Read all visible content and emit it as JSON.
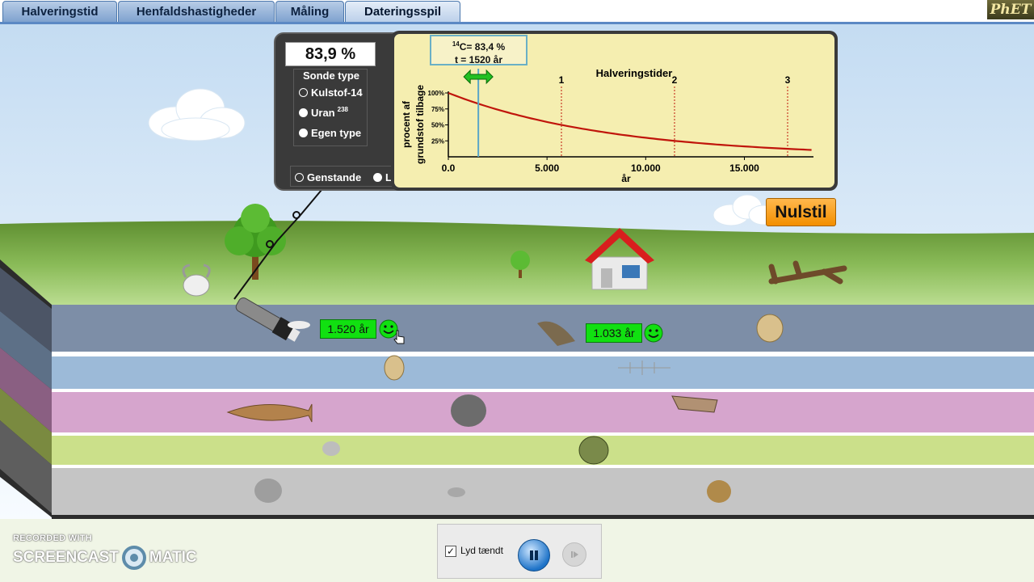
{
  "tabs": [
    {
      "label": "Halveringstid"
    },
    {
      "label": "Henfaldshastigheder"
    },
    {
      "label": "Måling"
    },
    {
      "label": "Dateringsspil"
    }
  ],
  "active_tab": "Dateringsspil",
  "logo_text": "PhET",
  "probe": {
    "reading": "83,9 %",
    "type_title": "Sonde type",
    "options": [
      {
        "label": "Kulstof-14",
        "selected": true
      },
      {
        "label": "Uran",
        "superscript": "238",
        "selected": false
      },
      {
        "label": "Egen type",
        "selected": false
      }
    ],
    "mode_options": [
      {
        "label": "Genstande",
        "selected": true
      },
      {
        "label": "Luft",
        "selected": false
      }
    ]
  },
  "graph": {
    "tooltip_line1_sup": "14",
    "tooltip_line1": "C= 83,4 %",
    "tooltip_line2": "t = 1520 år",
    "title": "Halveringstider",
    "ylabel_line1": "procent af",
    "ylabel_line2": "grundstof tilbage",
    "xlabel": "år",
    "y_ticks": [
      "100%",
      "75%",
      "50%",
      "25%"
    ],
    "x_ticks": [
      "0.0",
      "5.000",
      "10.000",
      "15.000"
    ],
    "half_life_markers": [
      "1",
      "2",
      "3"
    ]
  },
  "chart_data": {
    "type": "line",
    "title": "Halveringstider",
    "xlabel": "år",
    "ylabel": "procent af grundstof tilbage",
    "xlim": [
      0,
      18500
    ],
    "ylim": [
      0,
      100
    ],
    "half_life_years": 5730,
    "cursor_x": 1520,
    "series": [
      {
        "values": [
          {
            "x": 0,
            "y": 100
          },
          {
            "x": 1000,
            "y": 88.6
          },
          {
            "x": 2000,
            "y": 78.5
          },
          {
            "x": 3000,
            "y": 69.6
          },
          {
            "x": 4000,
            "y": 61.6
          },
          {
            "x": 5730,
            "y": 50
          },
          {
            "x": 7000,
            "y": 42.9
          },
          {
            "x": 8500,
            "y": 35.8
          },
          {
            "x": 10000,
            "y": 29.8
          },
          {
            "x": 11460,
            "y": 25
          },
          {
            "x": 13000,
            "y": 20.7
          },
          {
            "x": 15000,
            "y": 16.3
          },
          {
            "x": 17190,
            "y": 12.5
          },
          {
            "x": 18500,
            "y": 10.7
          }
        ]
      }
    ],
    "grid": false
  },
  "reset_label": "Nulstil",
  "age_labels": [
    "1.520 år",
    "1.033 år"
  ],
  "controls": {
    "sound_label": "Lyd tændt",
    "sound_on": true
  },
  "watermark": {
    "top": "RECORDED WITH",
    "left": "SCREENCAST",
    "right": "MATIC"
  },
  "colors": {
    "sky_top": "#c4dcf2",
    "grass": "#7aa947",
    "layer1": "#7d8ea7",
    "layer2": "#9cbad8",
    "layer3": "#d6a5cd",
    "layer4": "#cbe08a",
    "layer5": "#c5c5c5",
    "decay_curve": "#c0150b",
    "age_label": "#11e011",
    "reset_button": "#f5a21c"
  }
}
